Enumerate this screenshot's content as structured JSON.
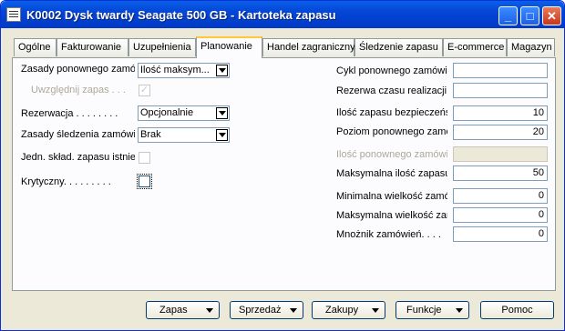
{
  "window": {
    "title": "K0002 Dysk twardy Seagate 500 GB - Kartoteka zapasu",
    "minimize_label": "_",
    "maximize_label": "□",
    "close_label": "✕"
  },
  "tabs": [
    {
      "label": "Ogólne"
    },
    {
      "label": "Fakturowanie"
    },
    {
      "label": "Uzupełnienia"
    },
    {
      "label": "Planowanie"
    },
    {
      "label": "Handel zagraniczny"
    },
    {
      "label": "Śledzenie zapasu"
    },
    {
      "label": "E-commerce"
    },
    {
      "label": "Magazyn"
    }
  ],
  "active_tab": "Planowanie",
  "left": {
    "reorder_policy": {
      "label": "Zasady ponownego zamówienia",
      "value": "Ilość maksym..."
    },
    "include_inventory": {
      "label": "Uwzględnij zapas . . .",
      "checked": true
    },
    "reserve": {
      "label": "Rezerwacja . . . . . . . .",
      "value": "Opcjonalnie"
    },
    "order_tracking_policy": {
      "label": "Zasady śledzenia zamówień",
      "value": "Brak"
    },
    "stockkeeping_unit_exists": {
      "label": "Jedn. skład. zapasu istnieje",
      "checked": false
    },
    "critical": {
      "label": "Krytyczny. . . . . . . . .",
      "checked": false
    }
  },
  "right": {
    "reorder_cycle": {
      "label": "Cykl ponownego zamówienia",
      "value": ""
    },
    "safety_lead_time": {
      "label": "Rezerwa czasu realizacji",
      "value": ""
    },
    "safety_stock_qty": {
      "label": "Ilość zapasu bezpieczeństwa",
      "value": "10"
    },
    "reorder_point": {
      "label": "Poziom ponownego zamówienia",
      "value": "20"
    },
    "reorder_qty": {
      "label": "Ilość ponownego zamówienia",
      "value": ""
    },
    "max_inventory": {
      "label": "Maksymalna ilość zapasu",
      "value": "50"
    },
    "min_order_qty": {
      "label": "Minimalna wielkość zamówienia",
      "value": "0"
    },
    "max_order_qty": {
      "label": "Maksymalna wielkość zamówienia",
      "value": "0"
    },
    "order_multiple": {
      "label": "Mnożnik zamówień. . . .",
      "value": "0"
    }
  },
  "buttons": {
    "item": "Zapas",
    "sales": "Sprzedaż",
    "purchases": "Zakupy",
    "functions": "Funkcje",
    "help": "Pomoc"
  }
}
